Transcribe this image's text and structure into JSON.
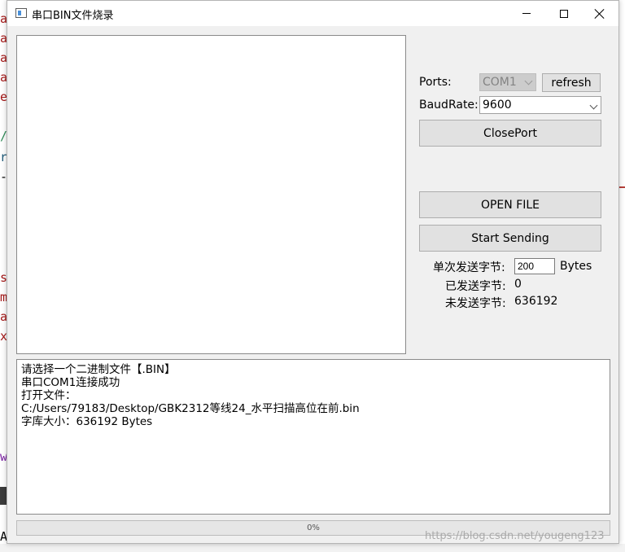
{
  "window": {
    "title": "串口BIN文件烧录"
  },
  "ports": {
    "label": "Ports:",
    "selected": "COM1",
    "refresh_label": "refresh"
  },
  "baud": {
    "label": "BaudRate:",
    "selected": "9600"
  },
  "buttons": {
    "close_port": "ClosePort",
    "open_file": "OPEN FILE",
    "start_sending": "Start Sending"
  },
  "stats": {
    "chunk_label": "单次发送字节:",
    "chunk_value": "200",
    "chunk_unit": "Bytes",
    "sent_label": "已发送字节:",
    "sent_value": "0",
    "remaining_label": "未发送字节:",
    "remaining_value": "636192"
  },
  "log": {
    "lines": [
      "请选择一个二进制文件【.BIN】",
      "串口COM1连接成功",
      "打开文件：",
      "C:/Users/79183/Desktop/GBK2312等线24_水平扫描高位在前.bin",
      "字库大小：636192 Bytes"
    ]
  },
  "progress": {
    "text": "0%",
    "value": 0
  },
  "watermark": "https://blog.csdn.net/yougeng123",
  "background_glyphs": [
    "a",
    "a",
    "a",
    "a",
    "e",
    "/",
    "r",
    "-",
    "s",
    "m",
    "a",
    "x",
    "w",
    "A"
  ]
}
